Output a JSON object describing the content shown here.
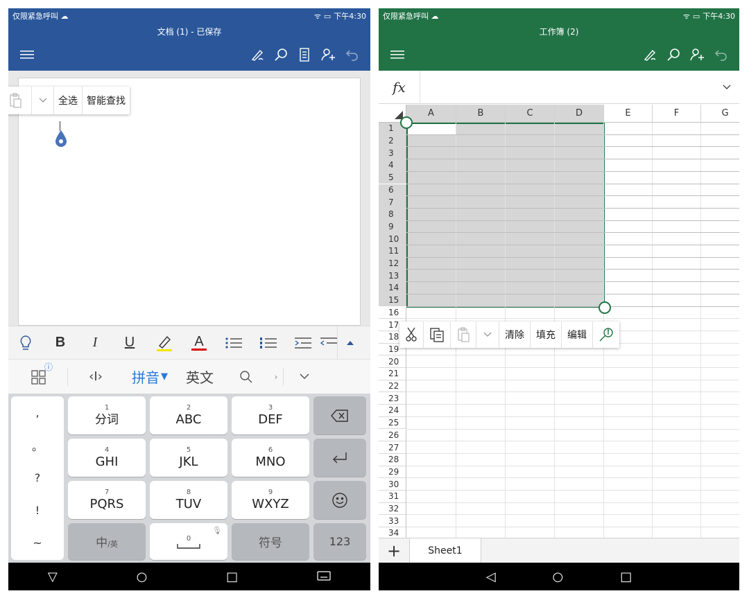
{
  "status": {
    "left_text": "仅限紧急呼叫",
    "time": "下午4:30"
  },
  "word": {
    "title": "文档 (1) - 已保存",
    "colors": {
      "brand": "#2b579a"
    },
    "context_menu": {
      "select_all": "全选",
      "smart_lookup": "智能查找"
    },
    "format_bar": {
      "bold": "B",
      "italic": "I",
      "underline": "U",
      "font_color": "A"
    },
    "ime": {
      "pinyin": "拼音",
      "english": "英文"
    },
    "keyboard": {
      "punct": [
        ",",
        "。",
        "?",
        "!",
        "~"
      ],
      "keys": [
        {
          "num": "1",
          "label": "分词"
        },
        {
          "num": "2",
          "label": "ABC"
        },
        {
          "num": "3",
          "label": "DEF"
        },
        {
          "num": "4",
          "label": "GHI"
        },
        {
          "num": "5",
          "label": "JKL"
        },
        {
          "num": "6",
          "label": "MNO"
        },
        {
          "num": "7",
          "label": "PQRS"
        },
        {
          "num": "8",
          "label": "TUV"
        },
        {
          "num": "9",
          "label": "WXYZ"
        }
      ],
      "zh_en": "中",
      "zh_en_sub": "/英",
      "space_num": "0",
      "symbols": "符号",
      "numbers": "123"
    }
  },
  "excel": {
    "title": "工作簿 (2)",
    "colors": {
      "brand": "#217346"
    },
    "fx_label": "fx",
    "columns": [
      "A",
      "B",
      "C",
      "D",
      "E",
      "F",
      "G"
    ],
    "rows": [
      "1",
      "2",
      "3",
      "4",
      "5",
      "6",
      "7",
      "8",
      "9",
      "10",
      "11",
      "12",
      "13",
      "14",
      "15",
      "16",
      "17",
      "18",
      "19",
      "20",
      "21",
      "22",
      "23",
      "24",
      "25",
      "26",
      "27",
      "28",
      "29",
      "30",
      "31",
      "32",
      "33",
      "34"
    ],
    "context_menu": {
      "clear": "清除",
      "fill": "填充",
      "edit": "编辑"
    },
    "sheet_tab": "Sheet1"
  }
}
